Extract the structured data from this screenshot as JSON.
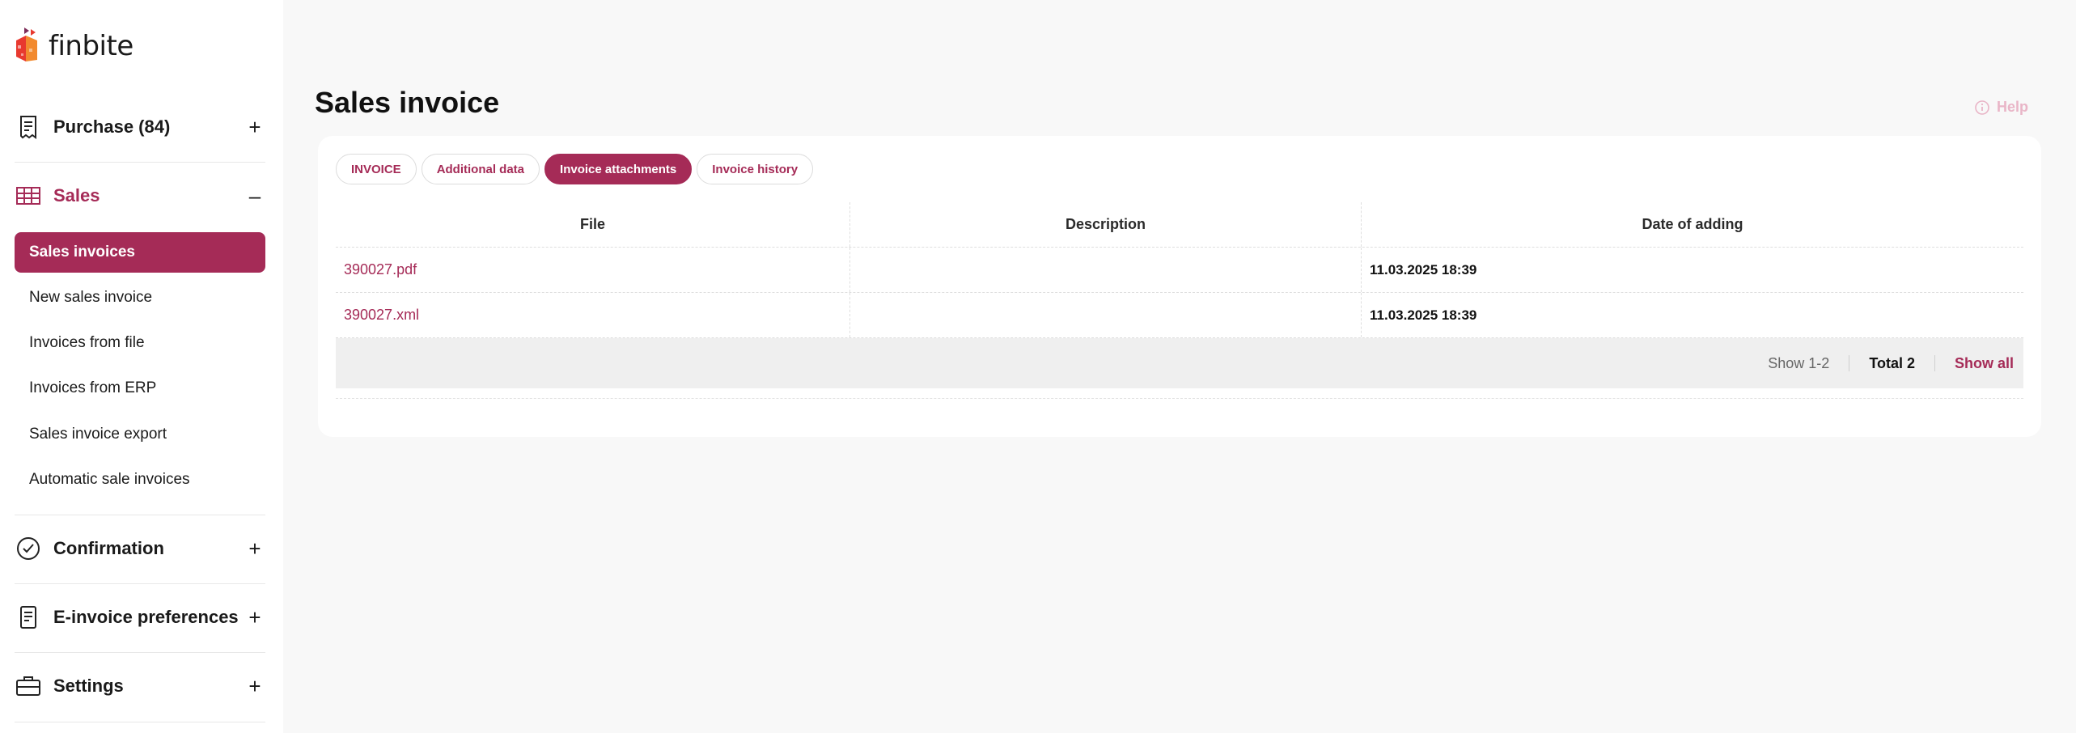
{
  "brand": {
    "name": "finbite",
    "accent_color": "#a52b57",
    "logo_colors": [
      "#e8392f",
      "#f28a2f",
      "#7d2c59"
    ]
  },
  "sidebar": {
    "sections": [
      {
        "label": "Purchase (84)",
        "icon": "receipt-icon",
        "toggle": "+",
        "expanded": false
      },
      {
        "label": "Sales",
        "icon": "table-grid-icon",
        "toggle": "–",
        "expanded": true,
        "items": [
          {
            "label": "Sales invoices",
            "selected": true
          },
          {
            "label": "New sales invoice"
          },
          {
            "label": "Invoices from file"
          },
          {
            "label": "Invoices from ERP"
          },
          {
            "label": "Sales invoice export"
          },
          {
            "label": "Automatic sale invoices"
          }
        ]
      },
      {
        "label": "Confirmation",
        "icon": "check-circle-icon",
        "toggle": "+",
        "expanded": false
      },
      {
        "label": "E-invoice preferences",
        "icon": "document-icon",
        "toggle": "+",
        "expanded": false
      },
      {
        "label": "Settings",
        "icon": "briefcase-icon",
        "toggle": "+",
        "expanded": false
      }
    ]
  },
  "main": {
    "title": "Sales invoice",
    "help_label": "Help",
    "tabs": [
      {
        "label": "INVOICE",
        "active": false
      },
      {
        "label": "Additional data",
        "active": false
      },
      {
        "label": "Invoice attachments",
        "active": true
      },
      {
        "label": "Invoice history",
        "active": false
      }
    ],
    "table": {
      "columns": [
        "File",
        "Description",
        "Date of adding"
      ],
      "rows": [
        {
          "file": "390027.pdf",
          "description": "",
          "date": "11.03.2025 18:39"
        },
        {
          "file": "390027.xml",
          "description": "",
          "date": "11.03.2025 18:39"
        }
      ]
    },
    "pagination": {
      "show_range": "Show 1-2",
      "total": "Total 2",
      "show_all": "Show all"
    }
  }
}
